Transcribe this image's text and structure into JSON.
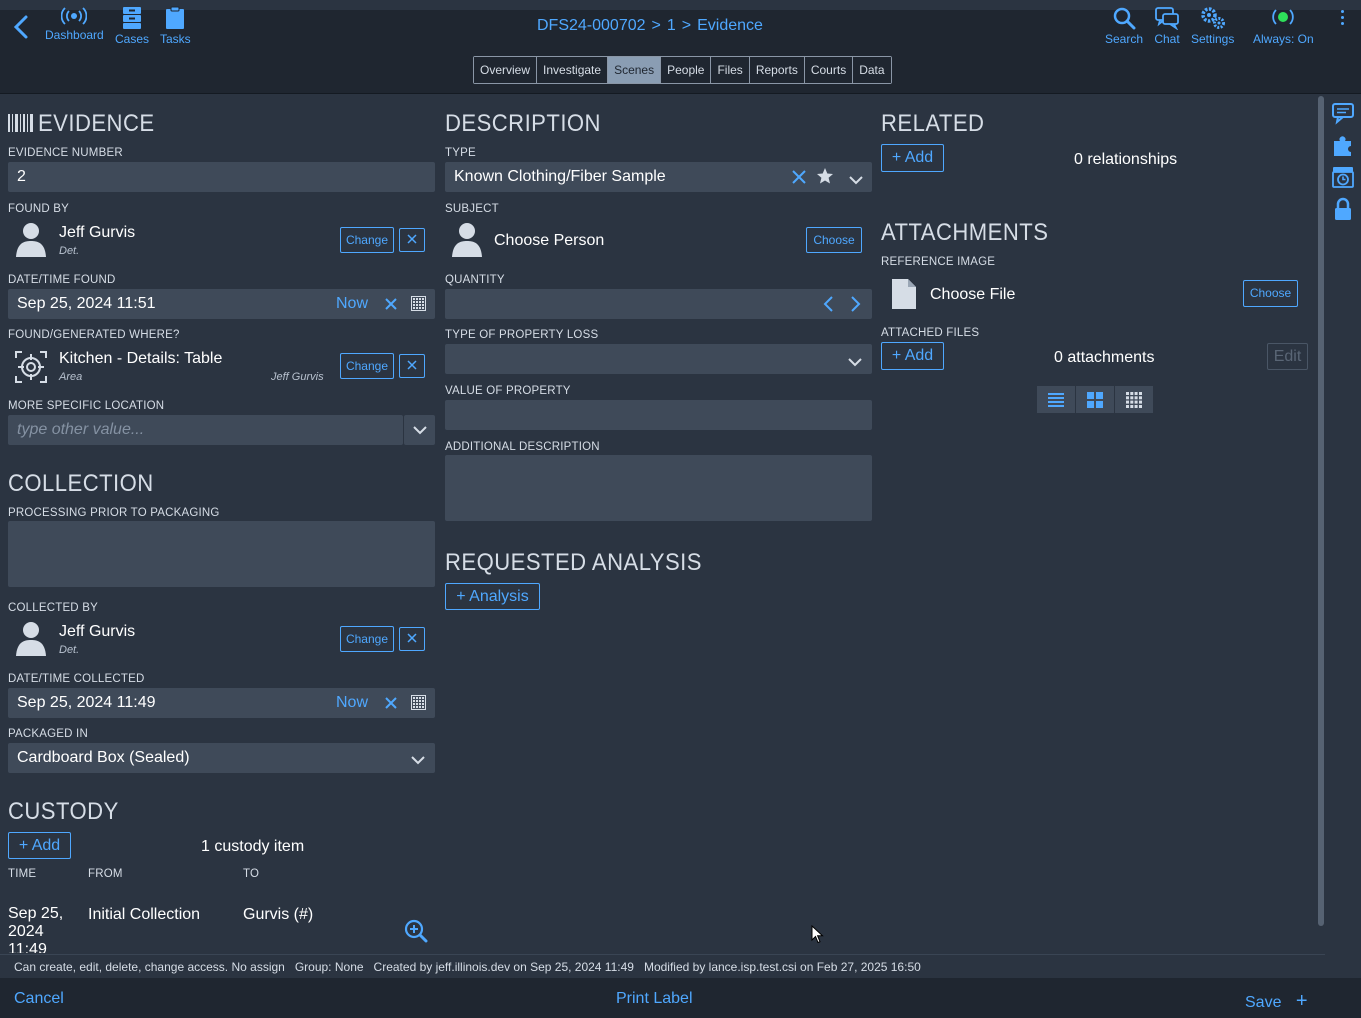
{
  "nav": {
    "dashboard": "Dashboard",
    "cases": "Cases",
    "tasks": "Tasks",
    "search": "Search",
    "chat": "Chat",
    "settings": "Settings",
    "always": "Always: On"
  },
  "breadcrumb": {
    "case": "DFS24-000702",
    "sep1": ">",
    "scene": "1",
    "sep2": ">",
    "page": "Evidence"
  },
  "tabs": [
    {
      "label": "Overview"
    },
    {
      "label": "Investigate"
    },
    {
      "label": "Scenes"
    },
    {
      "label": "People"
    },
    {
      "label": "Files"
    },
    {
      "label": "Reports"
    },
    {
      "label": "Courts"
    },
    {
      "label": "Data"
    }
  ],
  "evidence": {
    "heading": "EVIDENCE",
    "number_label": "EVIDENCE NUMBER",
    "number_value": "2",
    "found_by_label": "FOUND BY",
    "found_by_name": "Jeff Gurvis",
    "found_by_title": "Det.",
    "change_label": "Change",
    "datetime_found_label": "DATE/TIME FOUND",
    "datetime_found_value": "Sep 25, 2024 11:51",
    "now_label": "Now",
    "found_where_label": "FOUND/GENERATED WHERE?",
    "found_where_name": "Kitchen - Details: Table",
    "found_where_type": "Area",
    "found_where_by": "Jeff Gurvis",
    "specific_location_label": "MORE SPECIFIC LOCATION",
    "specific_location_placeholder": "type other value..."
  },
  "collection": {
    "heading": "COLLECTION",
    "processing_label": "PROCESSING PRIOR TO PACKAGING",
    "collected_by_label": "COLLECTED BY",
    "collected_by_name": "Jeff Gurvis",
    "collected_by_title": "Det.",
    "change_label": "Change",
    "datetime_collected_label": "DATE/TIME COLLECTED",
    "datetime_collected_value": "Sep 25, 2024 11:49",
    "now_label": "Now",
    "packaged_label": "PACKAGED IN",
    "packaged_value": "Cardboard Box (Sealed)"
  },
  "custody": {
    "heading": "CUSTODY",
    "add_label": "Add",
    "count_text": "1 custody item",
    "columns": [
      "TIME",
      "FROM",
      "TO"
    ],
    "rows": [
      {
        "time": "Sep 25, 2024 11:49",
        "from": "Initial Collection",
        "to": "Gurvis (#)"
      }
    ]
  },
  "description": {
    "heading": "DESCRIPTION",
    "type_label": "TYPE",
    "type_value": "Known Clothing/Fiber Sample",
    "subject_label": "SUBJECT",
    "subject_value": "Choose Person",
    "choose_label": "Choose",
    "quantity_label": "QUANTITY",
    "property_loss_label": "TYPE OF PROPERTY LOSS",
    "property_value_label": "VALUE OF PROPERTY",
    "additional_label": "ADDITIONAL DESCRIPTION"
  },
  "analysis": {
    "heading": "REQUESTED ANALYSIS",
    "add_label": "Analysis"
  },
  "related": {
    "heading": "RELATED",
    "add_label": "Add",
    "count_text": "0 relationships"
  },
  "attachments": {
    "heading": "ATTACHMENTS",
    "reference_label": "REFERENCE IMAGE",
    "choose_file": "Choose File",
    "choose_label": "Choose",
    "attached_label": "ATTACHED FILES",
    "add_label": "Add",
    "count_text": "0 attachments",
    "edit_label": "Edit"
  },
  "footer": {
    "access": "Can create, edit, delete, change access. No assign",
    "group": "Group: None",
    "created": "Created by jeff.illinois.dev on Sep 25, 2024 11:49",
    "modified": "Modified by lance.isp.test.csi on Feb 27, 2025 16:50"
  },
  "bottombar": {
    "cancel": "Cancel",
    "print": "Print Label",
    "save": "Save"
  },
  "colors": {
    "accent": "#4fa8ff",
    "background": "#2b3441",
    "field": "#3f4a59",
    "header": "#1f2630"
  }
}
